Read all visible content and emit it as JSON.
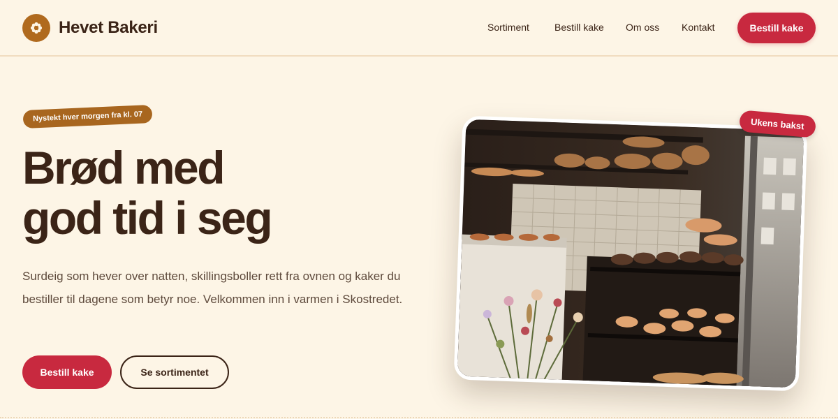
{
  "brand": {
    "name": "Hevet Bakeri",
    "icon": "flower-icon",
    "color": "#b06a1e"
  },
  "nav": {
    "items": [
      {
        "label": "Sortiment"
      },
      {
        "label": "Bestill kake"
      },
      {
        "label": "Om oss"
      },
      {
        "label": "Kontakt"
      }
    ],
    "cta_label": "Bestill kake"
  },
  "hero": {
    "badge": "Nystekt hver morgen fra kl. 07",
    "title_line1": "Brød med",
    "title_line2": "god tid i seg",
    "body": "Surdeig som hever over natten, skillingsboller rett fra ovnen og kaker du bestiller til dagene som betyr noe. Velkommen inn i varmen i Skostredet.",
    "primary_button": "Bestill kake",
    "secondary_button": "Se sortimentet",
    "photo_badge": "Ukens bakst"
  },
  "colors": {
    "background": "#fdf5e6",
    "accent": "#c8293f",
    "brown": "#3b2417",
    "badge_brown": "#a8661f"
  }
}
